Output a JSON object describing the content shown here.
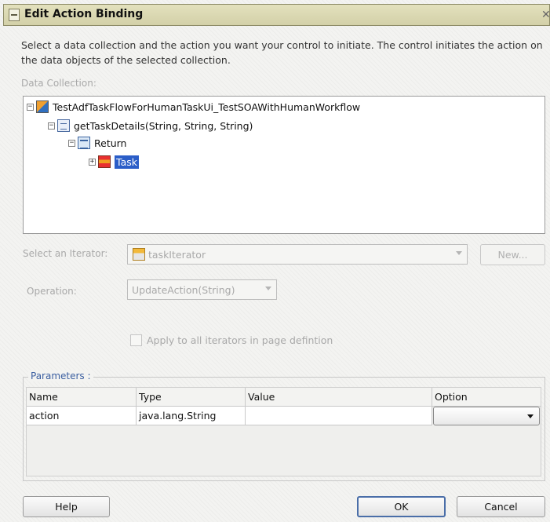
{
  "dialog": {
    "title": "Edit Action Binding",
    "description": "Select a data collection and the action you want your control to initiate. The control initiates the action on the data objects of the selected collection."
  },
  "data_collection": {
    "label": "Data Collection:",
    "tree": [
      {
        "label": "TestAdfTaskFlowForHumanTaskUi_TestSOAWithHumanWorkflow",
        "icon": "data-control-icon",
        "expander": "−"
      },
      {
        "label": "getTaskDetails(String, String, String)",
        "icon": "method-icon",
        "expander": "−"
      },
      {
        "label": "Return",
        "icon": "return-icon",
        "expander": "−"
      },
      {
        "label": "Task",
        "icon": "collection-icon",
        "expander": "+",
        "selected": true
      }
    ]
  },
  "iterator": {
    "label": "Select an Iterator:",
    "value": "taskIterator",
    "new_button": "New..."
  },
  "operation": {
    "label": "Operation:",
    "value": "UpdateAction(String)"
  },
  "apply_checkbox": {
    "label": "Apply to all iterators in page defintion",
    "checked": false
  },
  "parameters": {
    "legend": "Parameters :",
    "columns": [
      "Name",
      "Type",
      "Value",
      "Option"
    ],
    "rows": [
      {
        "name": "action",
        "type": "java.lang.String",
        "value": "",
        "option": ""
      }
    ]
  },
  "footer": {
    "help": "Help",
    "ok": "OK",
    "cancel": "Cancel"
  },
  "colors": {
    "title_bar": "#d8d6b0",
    "selection": "#2b5ec8",
    "legend_text": "#3a5ea0"
  }
}
